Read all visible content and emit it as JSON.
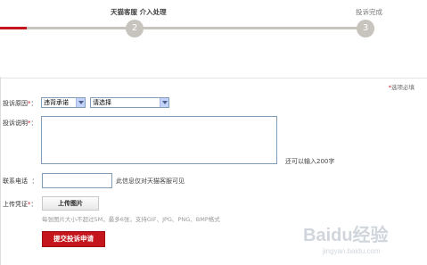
{
  "progress": {
    "step2_label": "天猫客服 介入处理",
    "step2_number": "2",
    "step3_label": "投诉完成",
    "step3_number": "3"
  },
  "form": {
    "required_note_star": "*",
    "required_note": "选项必填",
    "reason_label": "投诉原因",
    "reason_value": "违背承诺",
    "sub_reason_value": "请选择",
    "description_label": "投诉说明",
    "description_hint": "还可以输入200字",
    "phone_label": "联系电话",
    "phone_hint": "此信息仅对天猫客服可见",
    "upload_label": "上传凭证",
    "upload_button": "上传图片",
    "upload_hint": "每张图片大小不超过5M，最多6张，支持GIF、JPG、PNG、BMP格式",
    "submit_button": "提交投诉申请",
    "required_star": "*"
  },
  "watermark": {
    "text": "Baidu经验",
    "url": "jingyan.baidu.com"
  },
  "colors": {
    "accent": "#c4161c",
    "track": "#c7c3bd"
  }
}
